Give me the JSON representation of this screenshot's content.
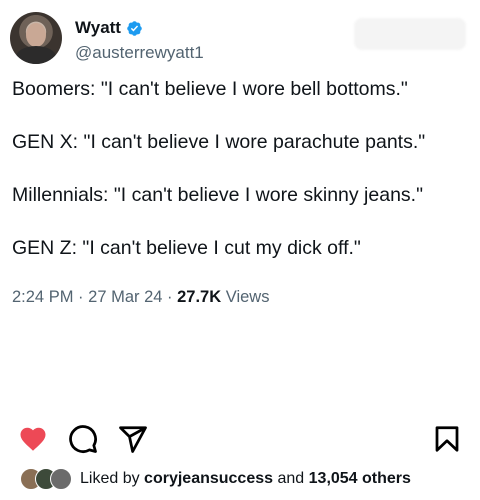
{
  "tweet": {
    "display_name": "Wyatt",
    "handle": "@austerrewyatt1",
    "lines": [
      "Boomers: \"I can't believe I wore bell bottoms.\"",
      "GEN X: \"I can't believe I wore parachute pants.\"",
      "Millennials: \"I can't believe I wore skinny jeans.\"",
      "GEN Z: \"I can't believe I cut my dick off.\""
    ],
    "time": "2:24 PM",
    "separator": "·",
    "date": "27 Mar 24",
    "views_count": "27.7K",
    "views_label": "Views"
  },
  "post": {
    "liked_by_prefix": "Liked by",
    "liked_by_user": "coryjeansuccess",
    "liked_by_and": "and",
    "liked_by_count": "13,054 others"
  },
  "colors": {
    "like_red": "#ed4956",
    "verified_blue": "#1d9bf0",
    "secondary_text": "#536471"
  },
  "icons": [
    "verified-badge-icon",
    "heart-icon",
    "comment-icon",
    "share-icon",
    "bookmark-icon"
  ]
}
